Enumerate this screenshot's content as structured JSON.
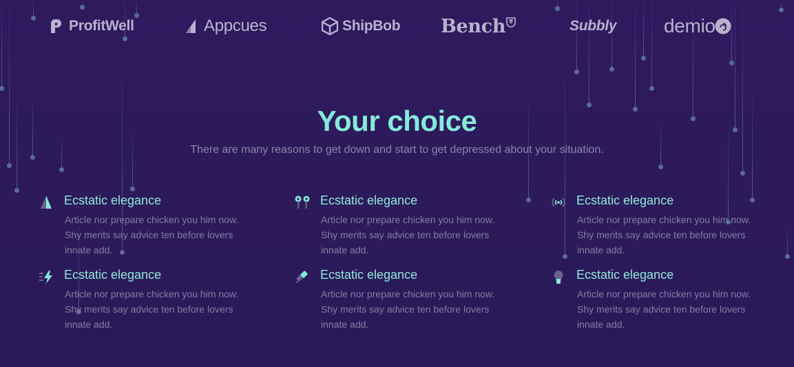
{
  "logos": {
    "profitwell": "ProfitWell",
    "appcues": "Appcues",
    "shipbob": "ShipBob",
    "bench": "Bench",
    "subbly": "Subbly",
    "demio": "demio"
  },
  "section": {
    "title": "Your choice",
    "subtitle": "There are many reasons to get down and start to get depressed about your situation."
  },
  "features": [
    {
      "icon": "prism-icon",
      "title": "Ecstatic elegance",
      "description": "Article nor prepare chicken you him now. Shy merits say advice ten before lovers innate add."
    },
    {
      "icon": "earbuds-icon",
      "title": "Ecstatic elegance",
      "description": "Article nor prepare chicken you him now. Shy merits say advice ten before lovers innate add."
    },
    {
      "icon": "broadcast-icon",
      "title": "Ecstatic elegance",
      "description": "Article nor prepare chicken you him now. Shy merits say advice ten before lovers innate add."
    },
    {
      "icon": "lightning-icon",
      "title": "Ecstatic elegance",
      "description": "Article nor prepare chicken you him now. Shy merits say advice ten before lovers innate add."
    },
    {
      "icon": "pen-icon",
      "title": "Ecstatic elegance",
      "description": "Article nor prepare chicken you him now. Shy merits say advice ten before lovers innate add."
    },
    {
      "icon": "lightbulb-icon",
      "title": "Ecstatic elegance",
      "description": "Article nor prepare chicken you him now. Shy merits say advice ten before lovers innate add."
    }
  ],
  "colors": {
    "background": "#2d1a5c",
    "accent": "#86ead9",
    "muted_text": "#857ca3",
    "logo_gray": "#b9b2cf"
  }
}
